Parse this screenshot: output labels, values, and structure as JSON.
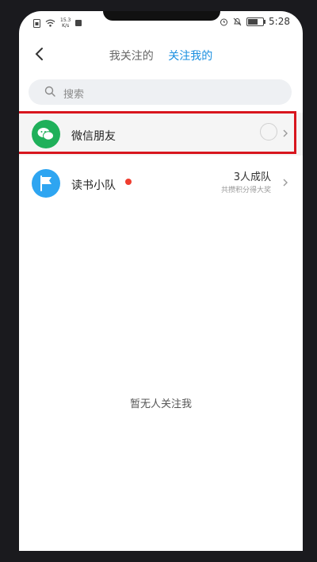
{
  "status_bar": {
    "net_speed": "15.3\nK/s",
    "time": "5:28"
  },
  "header": {
    "tabs": [
      {
        "label": "我关注的",
        "active": false
      },
      {
        "label": "关注我的",
        "active": true
      }
    ]
  },
  "search": {
    "placeholder": "搜索"
  },
  "list": [
    {
      "title": "微信朋友",
      "icon": "wechat-icon",
      "highlighted": true
    },
    {
      "title": "读书小队",
      "icon": "flag-icon",
      "badge": "red-dot",
      "right_main": "3人成队",
      "right_sub": "共攒积分得大奖"
    }
  ],
  "empty_state": {
    "text": "暂无人关注我"
  },
  "colors": {
    "accent": "#1a8fe0",
    "highlight": "#d8161e",
    "wechat": "#1fb05a",
    "flag": "#2ea5f1"
  }
}
